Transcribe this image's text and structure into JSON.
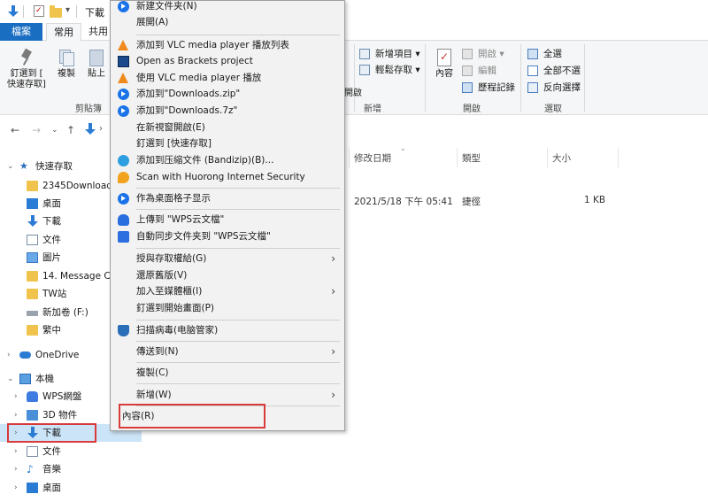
{
  "window": {
    "title": "下載"
  },
  "ribbon": {
    "tabs": {
      "file": "檔案",
      "home": "常用",
      "share": "共用"
    },
    "pin_quick_access": "釘選到 [\n快速存取]",
    "copy": "複製",
    "paste": "貼上",
    "clipboard_group": "剪貼簿",
    "open_label": "開啟",
    "new_group": "新增",
    "new_item": "新增項目",
    "easy_access": "輕鬆存取",
    "properties": "內容",
    "open_menu": "開啟",
    "edit": "編輯",
    "history": "歷程記錄",
    "open_group": "開啟",
    "select_all": "全選",
    "select_none": "全部不選",
    "invert_selection": "反向選擇",
    "select_group": "選取"
  },
  "columns": {
    "date": "修改日期",
    "type": "類型",
    "size": "大小"
  },
  "file_row": {
    "date": "2021/5/18 下午 05:41",
    "type": "捷徑",
    "size": "1 KB"
  },
  "nav": {
    "quick_access": "快速存取",
    "folder_2345": "2345Downloads",
    "desktop": "桌面",
    "downloads": "下載",
    "documents": "文件",
    "pictures": "圖片",
    "message_center": "14. Message Ce",
    "tw_station": "TW站",
    "new_volume": "新加卷 (F:)",
    "fanzhong": "繁中",
    "onedrive": "OneDrive",
    "this_pc": "本機",
    "wps_disk": "WPS網盤",
    "objects_3d": "3D 物件",
    "pc_downloads": "下載",
    "pc_documents": "文件",
    "music": "音樂",
    "pc_desktop": "桌面"
  },
  "menu": {
    "new_folder": "新建文件夹(N)",
    "expand": "展開(A)",
    "vlc_add_playlist": "添加到 VLC media player 播放列表",
    "open_brackets": "Open as Brackets project",
    "vlc_play": "使用 VLC media player 播放",
    "add_zip": "添加到\"Downloads.zip\"",
    "add_7z": "添加到\"Downloads.7z\"",
    "open_new_window": "在新視窗開啟(E)",
    "pin_quick_access": "釘選到 [快速存取]",
    "bandizip": "添加到压縮文件 (Bandizip)(B)...",
    "huorong": "Scan with Huorong Internet Security",
    "desktop_grid": "作為桌面格子显示",
    "upload_wps": "上傳到 \"WPS云文檔\"",
    "sync_wps": "自動同步文件夹到 \"WPS云文檔\"",
    "grant_access": "授與存取權給(G)",
    "restore_versions": "還原舊版(V)",
    "include_library": "加入至媒體櫃(I)",
    "pin_start": "釘選到開始畫面(P)",
    "scan_virus": "扫描病毒(电脑管家)",
    "send_to": "傳送到(N)",
    "copy": "複製(C)",
    "new": "新增(W)",
    "properties": "內容(R)"
  },
  "colors": {
    "accent": "#1a6ec2",
    "highlight": "#d93b3b",
    "selection": "#cce4f7"
  }
}
